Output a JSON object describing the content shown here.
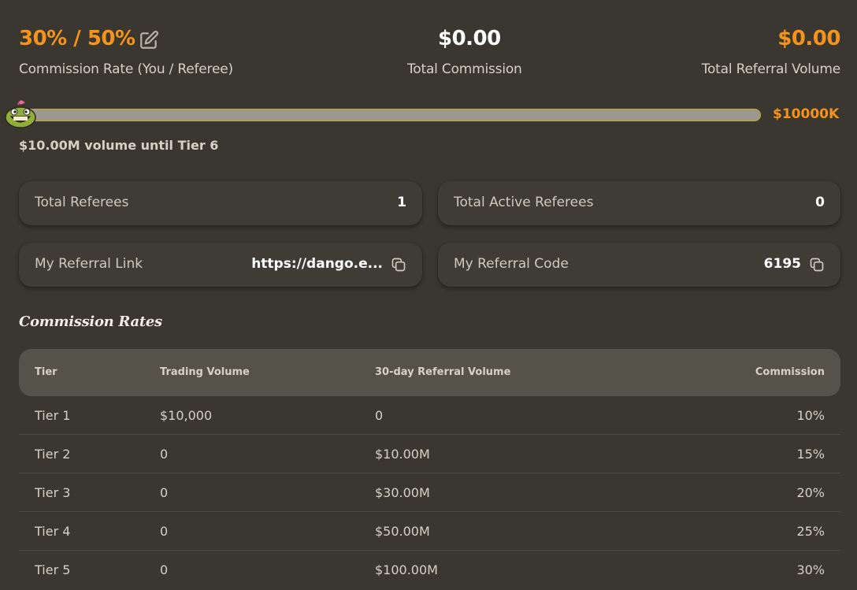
{
  "header": {
    "commission_rate": "30% / 50%",
    "commission_rate_label": "Commission Rate (You / Referee)",
    "total_commission": "$0.00",
    "total_commission_label": "Total Commission",
    "total_referral_volume": "$0.00",
    "total_referral_volume_label": "Total Referral Volume"
  },
  "progress": {
    "fraction": 0.0,
    "goal_label": "$10000K",
    "note": "$10.00M volume until Tier 6"
  },
  "cards": {
    "total_referees_label": "Total Referees",
    "total_referees_value": "1",
    "total_active_referees_label": "Total Active Referees",
    "total_active_referees_value": "0",
    "referral_link_label": "My Referral Link",
    "referral_link_value": "https://dango.e...",
    "referral_code_label": "My Referral Code",
    "referral_code_value": "6195"
  },
  "rates": {
    "title": "Commission Rates",
    "headers": [
      "Tier",
      "Trading Volume",
      "30-day Referral Volume",
      "Commission"
    ],
    "rows": [
      [
        "Tier 1",
        "$10,000",
        "0",
        "10%"
      ],
      [
        "Tier 2",
        "0",
        "$10.00M",
        "15%"
      ],
      [
        "Tier 3",
        "0",
        "$30.00M",
        "20%"
      ],
      [
        "Tier 4",
        "0",
        "$50.00M",
        "25%"
      ],
      [
        "Tier 5",
        "0",
        "$100.00M",
        "30%"
      ]
    ]
  },
  "colors": {
    "accent": "#f6931a",
    "background": "#3a3730"
  },
  "icons": [
    "edit-icon",
    "copy-icon",
    "mascot-icon"
  ]
}
